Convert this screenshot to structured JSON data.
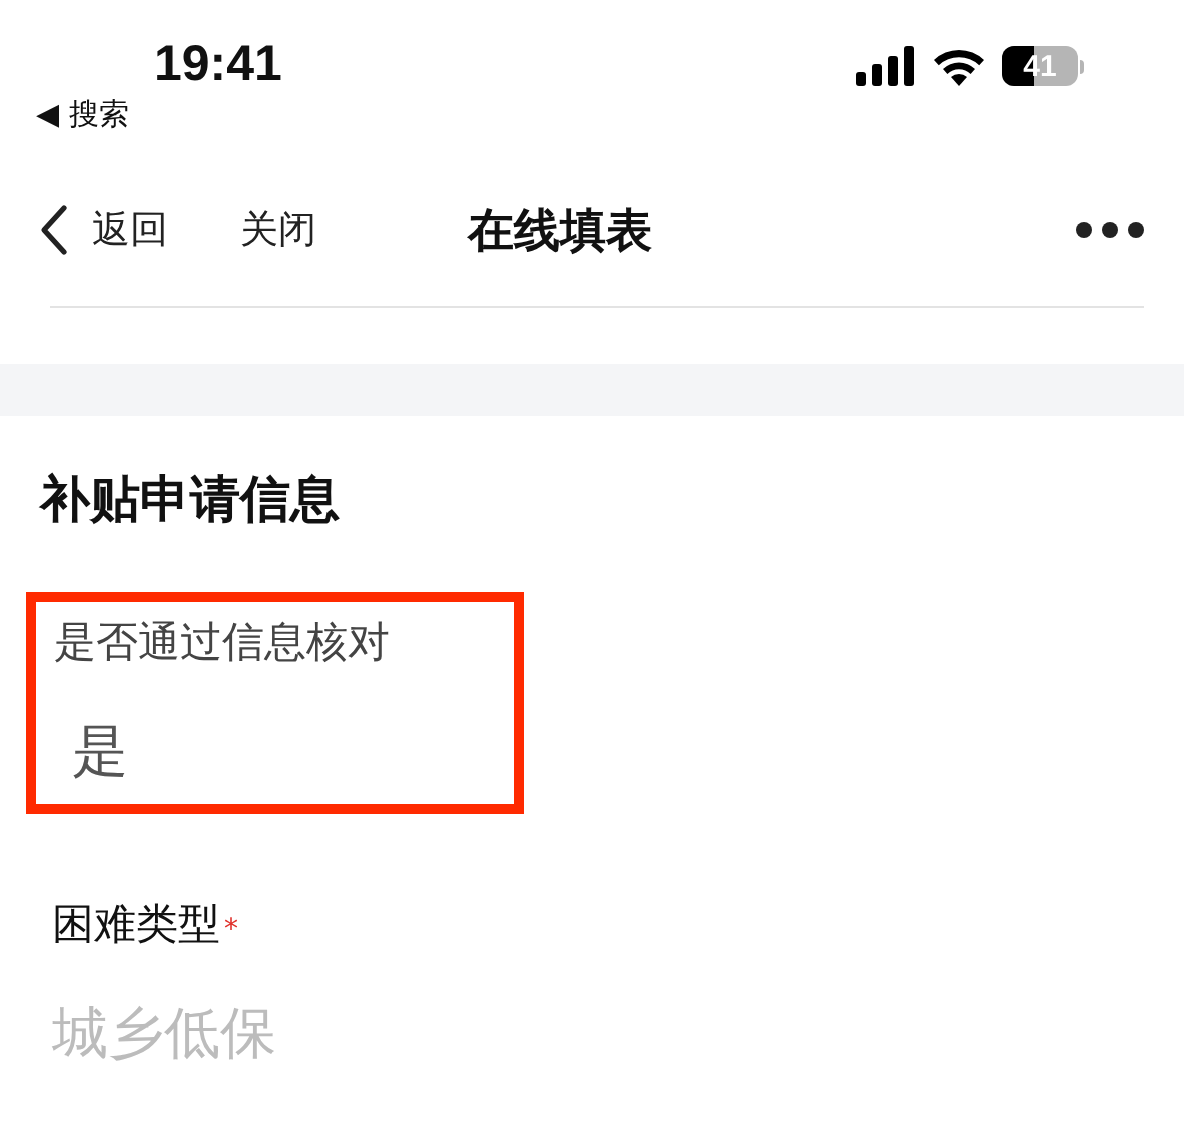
{
  "status_bar": {
    "time": "19:41",
    "back_app": "◀ 搜索",
    "battery": "41"
  },
  "nav_bar": {
    "back": "返回",
    "close": "关闭",
    "title": "在线填表"
  },
  "section": {
    "title": "补贴申请信息"
  },
  "fields": [
    {
      "label": "是否通过信息核对",
      "value": "是",
      "highlighted": true,
      "disabled": false
    },
    {
      "label": "困难类型",
      "required_mark": "*",
      "value": "城乡低保",
      "highlighted": false,
      "disabled": true
    }
  ]
}
